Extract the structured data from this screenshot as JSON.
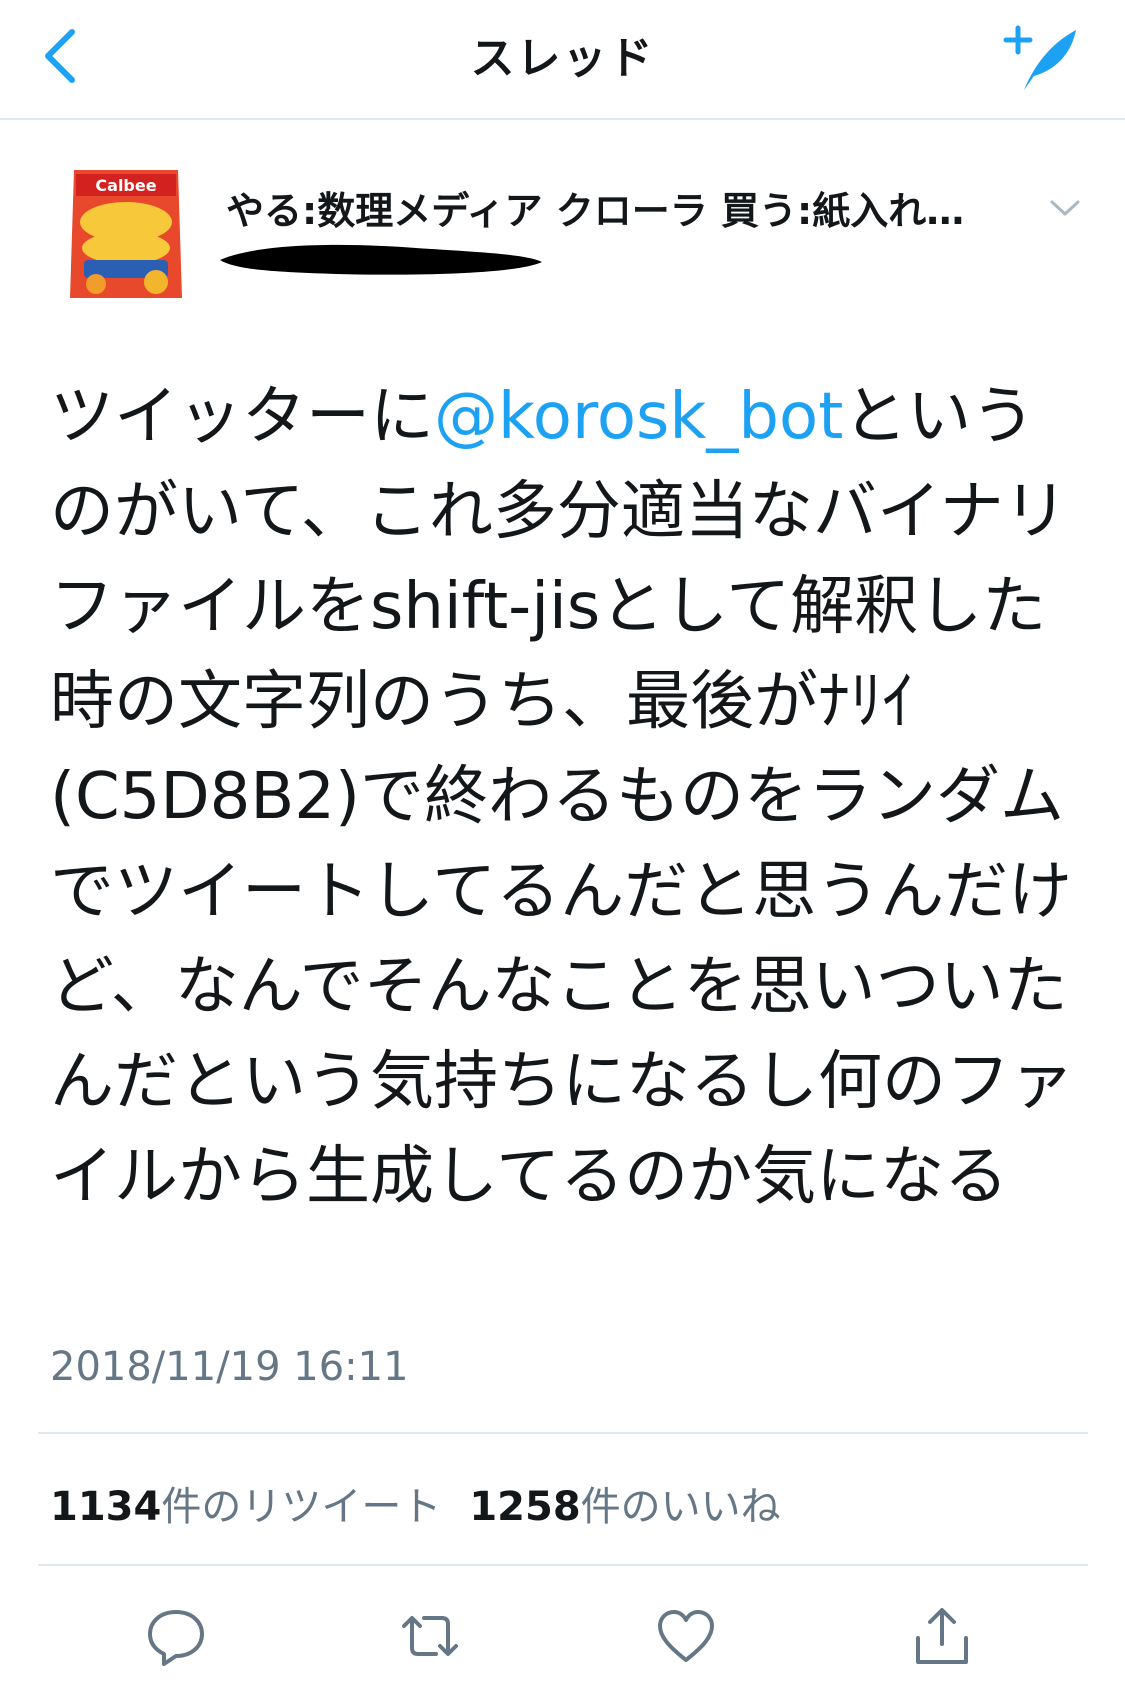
{
  "nav": {
    "title": "スレッド",
    "back_icon": "chevron-left-icon",
    "compose_icon": "compose-tweet-icon"
  },
  "author": {
    "display_name": "やる:数理メディア クローラ 買う:紙入れ…",
    "avatar_icon": "potato-chips-bag-avatar"
  },
  "tweet": {
    "text_before": "ツイッターに",
    "mention": "@korosk_bot",
    "text_after": "というのがいて、これ多分適当なバイナリファイルをshift-jisとして解釈した時の文字列のうち、最後がﾅﾘｲ(C5D8B2)で終わるものをランダムでツイートしてるんだと思うんだけど、なんでそんなことを思いついたんだという気持ちになるし何のファイルから生成してるのか気になる",
    "timestamp": "2018/11/19 16:11"
  },
  "stats": {
    "retweet_count": "1134",
    "retweet_label": "件のリツイート",
    "like_count": "1258",
    "like_label": "件のいいね"
  },
  "actions": [
    "reply-icon",
    "retweet-icon",
    "like-icon",
    "share-icon"
  ],
  "colors": {
    "accent": "#1da1f2",
    "text": "#14171a",
    "muted": "#657786",
    "divider": "#e1e8ed"
  }
}
